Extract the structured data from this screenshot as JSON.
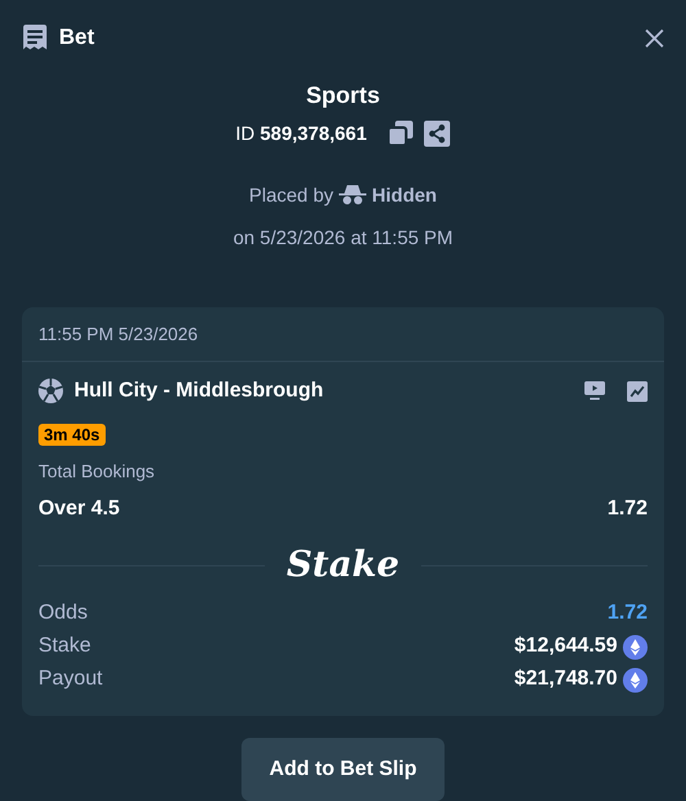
{
  "window": {
    "title": "Bet"
  },
  "summary": {
    "heading": "Sports",
    "id_line": "ID **589,378,661**",
    "placed_label": "Placed by",
    "placed_user": "Hidden",
    "placed_on": "on 5/23/2026 at 11:55 PM"
  },
  "bet_card": {
    "timestamp": "11:55 PM 5/23/2026",
    "event": "Hull City - Middlesbrough",
    "timer": "3m 40s",
    "market": "Total Bookings",
    "selection": "Over 4.5",
    "selection_odds": "1.72",
    "logo": "Stake",
    "details": [
      {
        "label": "Odds",
        "value": "1.72",
        "kind": "odds"
      },
      {
        "label": "Stake",
        "value": "$12,644.59",
        "kind": "amount"
      },
      {
        "label": "Payout",
        "value": "$21,748.70",
        "kind": "amount"
      }
    ]
  },
  "buttons": [
    "Add to Bet Slip"
  ]
}
